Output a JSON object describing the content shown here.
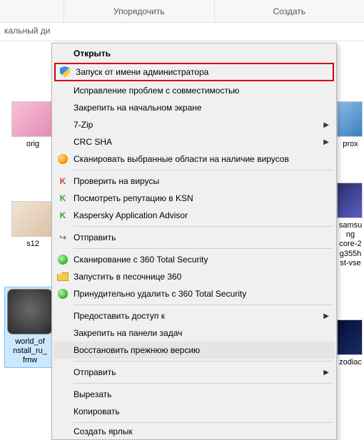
{
  "toolbar": {
    "organize": "Упорядочить",
    "create": "Создать"
  },
  "breadcrumb": "кальный ди",
  "files": {
    "f1": "orig",
    "f2": "s12",
    "f3": "world_of\nnstall_ru_\nfmw",
    "f4": "prox",
    "f5": "samsung\ncore-2\ng355h\nst-vse",
    "f6": "zodiac"
  },
  "menu": {
    "open": "Открыть",
    "run_admin": "Запуск от имени администратора",
    "compat": "Исправление проблем с совместимостью",
    "pin_start": "Закрепить на начальном экране",
    "sevenzip": "7-Zip",
    "crc": "CRC SHA",
    "scan_virus_areas": "Сканировать выбранные области на наличие вирусов",
    "check_virus": "Проверить на вирусы",
    "ksn": "Посмотреть репутацию в KSN",
    "kaa": "Kaspersky Application Advisor",
    "sendto": "Отправить",
    "scan360": "Сканирование с 360 Total Security",
    "sandbox360": "Запустить в песочнице 360",
    "forcedel360": "Принудительно удалить с  360 Total Security",
    "grant_access": "Предоставить доступ к",
    "pin_taskbar": "Закрепить на панели задач",
    "restore_prev": "Восстановить прежнюю версию",
    "sendto2": "Отправить",
    "cut": "Вырезать",
    "copy": "Копировать",
    "shortcut": "Создать ярлык"
  }
}
